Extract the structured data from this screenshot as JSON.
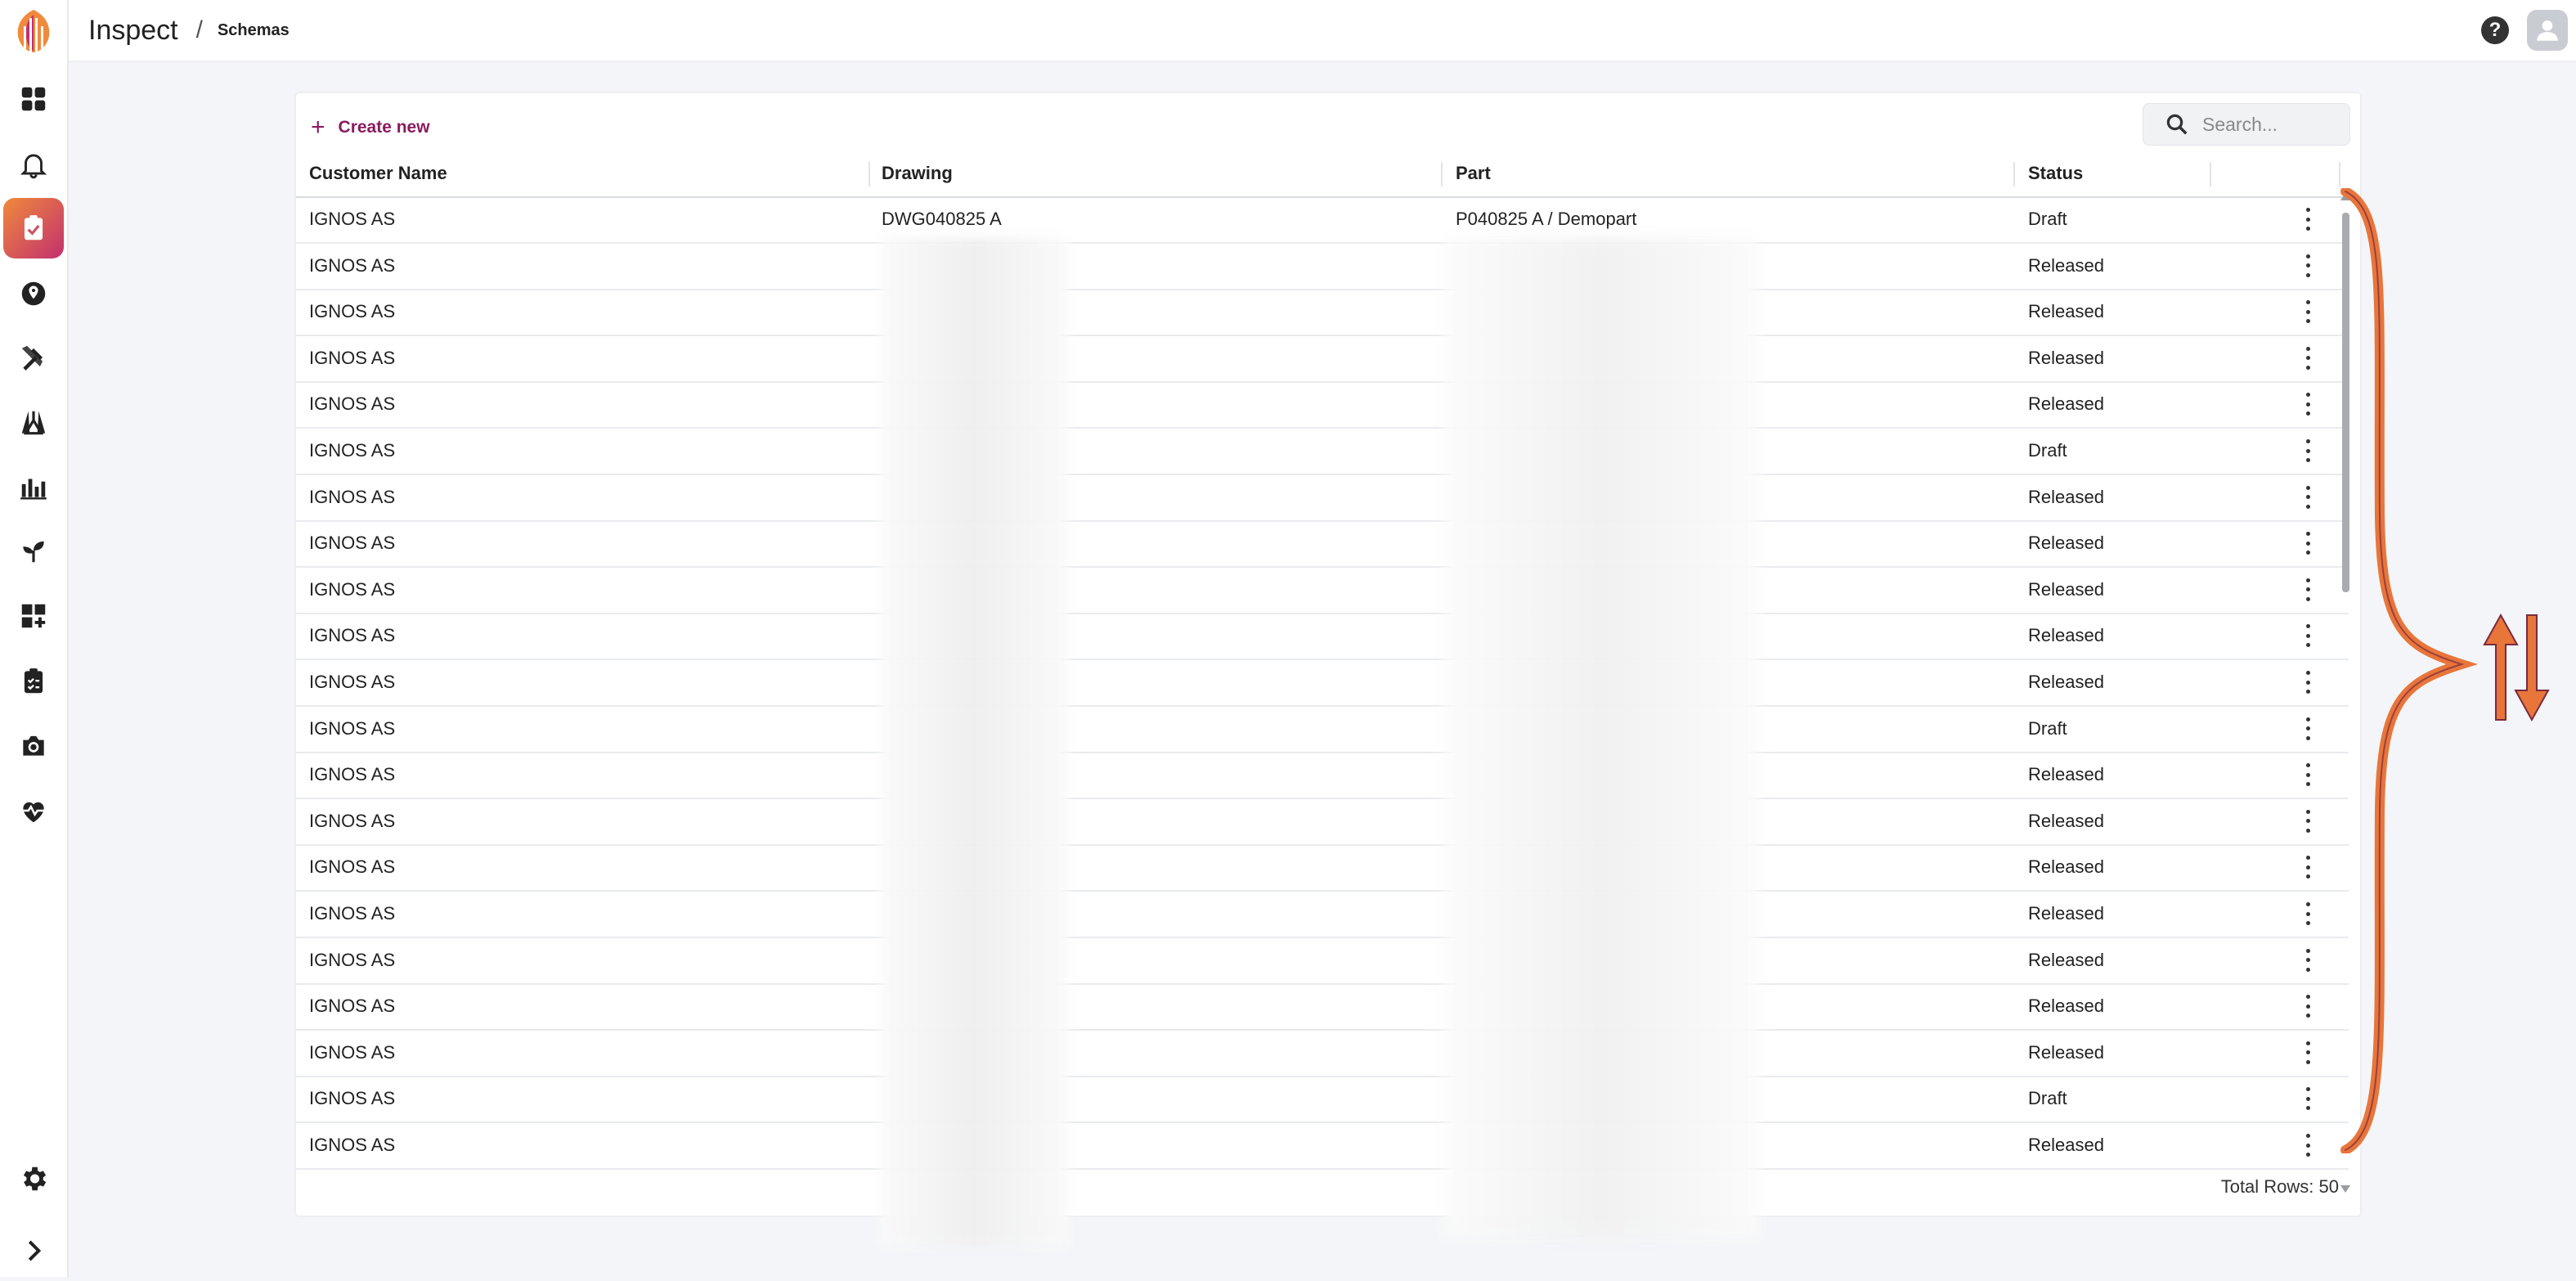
{
  "app": {
    "title": "Inspect",
    "breadcrumb_sep": "/",
    "breadcrumb": "Schemas"
  },
  "topbar": {
    "help_icon": "question-circle-icon",
    "avatar_icon": "user-avatar-icon"
  },
  "sidebar": {
    "items": [
      {
        "icon": "dashboard-grid-icon"
      },
      {
        "icon": "bell-icon"
      },
      {
        "icon": "clipboard-check-icon",
        "active": true
      },
      {
        "icon": "globe-pin-icon"
      },
      {
        "icon": "hammer-tools-icon"
      },
      {
        "icon": "flask-icon"
      },
      {
        "icon": "bar-chart-icon"
      },
      {
        "icon": "sprout-icon"
      },
      {
        "icon": "widget-add-icon"
      },
      {
        "icon": "clipboard-list-icon"
      },
      {
        "icon": "camera-icon"
      },
      {
        "icon": "heart-pulse-icon"
      }
    ],
    "settings_icon": "gear-icon",
    "expand_icon": "chevron-right-icon"
  },
  "toolbar": {
    "create_label": "Create new",
    "search_placeholder": "Search..."
  },
  "table": {
    "columns": [
      "Customer Name",
      "Drawing",
      "Part",
      "Status"
    ],
    "rows": [
      {
        "customer": "IGNOS AS",
        "drawing": "DWG040825 A",
        "part": "P040825 A / Demopart",
        "status": "Draft"
      },
      {
        "customer": "IGNOS AS",
        "drawing": "",
        "part": "",
        "status": "Released"
      },
      {
        "customer": "IGNOS AS",
        "drawing": "",
        "part": "",
        "status": "Released"
      },
      {
        "customer": "IGNOS AS",
        "drawing": "",
        "part": "",
        "status": "Released"
      },
      {
        "customer": "IGNOS AS",
        "drawing": "",
        "part": "",
        "status": "Released"
      },
      {
        "customer": "IGNOS AS",
        "drawing": "",
        "part": "",
        "status": "Draft"
      },
      {
        "customer": "IGNOS AS",
        "drawing": "",
        "part": "",
        "status": "Released"
      },
      {
        "customer": "IGNOS AS",
        "drawing": "",
        "part": "",
        "status": "Released"
      },
      {
        "customer": "IGNOS AS",
        "drawing": "",
        "part": "",
        "status": "Released"
      },
      {
        "customer": "IGNOS AS",
        "drawing": "",
        "part": "",
        "status": "Released"
      },
      {
        "customer": "IGNOS AS",
        "drawing": "",
        "part": "",
        "status": "Released"
      },
      {
        "customer": "IGNOS AS",
        "drawing": "",
        "part": "",
        "status": "Draft"
      },
      {
        "customer": "IGNOS AS",
        "drawing": "",
        "part": "",
        "status": "Released"
      },
      {
        "customer": "IGNOS AS",
        "drawing": "",
        "part": "",
        "status": "Released"
      },
      {
        "customer": "IGNOS AS",
        "drawing": "",
        "part": "",
        "status": "Released"
      },
      {
        "customer": "IGNOS AS",
        "drawing": "",
        "part": "",
        "status": "Released"
      },
      {
        "customer": "IGNOS AS",
        "drawing": "",
        "part": "",
        "status": "Released"
      },
      {
        "customer": "IGNOS AS",
        "drawing": "",
        "part": "",
        "status": "Released"
      },
      {
        "customer": "IGNOS AS",
        "drawing": "",
        "part": "",
        "status": "Released"
      },
      {
        "customer": "IGNOS AS",
        "drawing": "",
        "part": "",
        "status": "Draft"
      },
      {
        "customer": "IGNOS AS",
        "drawing": "",
        "part": "",
        "status": "Released"
      }
    ],
    "row_menu_icon": "kebab-menu-icon",
    "total_rows_label": "Total Rows: 50"
  },
  "colors": {
    "accent": "#8a1b5f",
    "active_gradient_start": "#f08a3c",
    "active_gradient_end": "#c2306e",
    "annotation": "#e8753a"
  }
}
